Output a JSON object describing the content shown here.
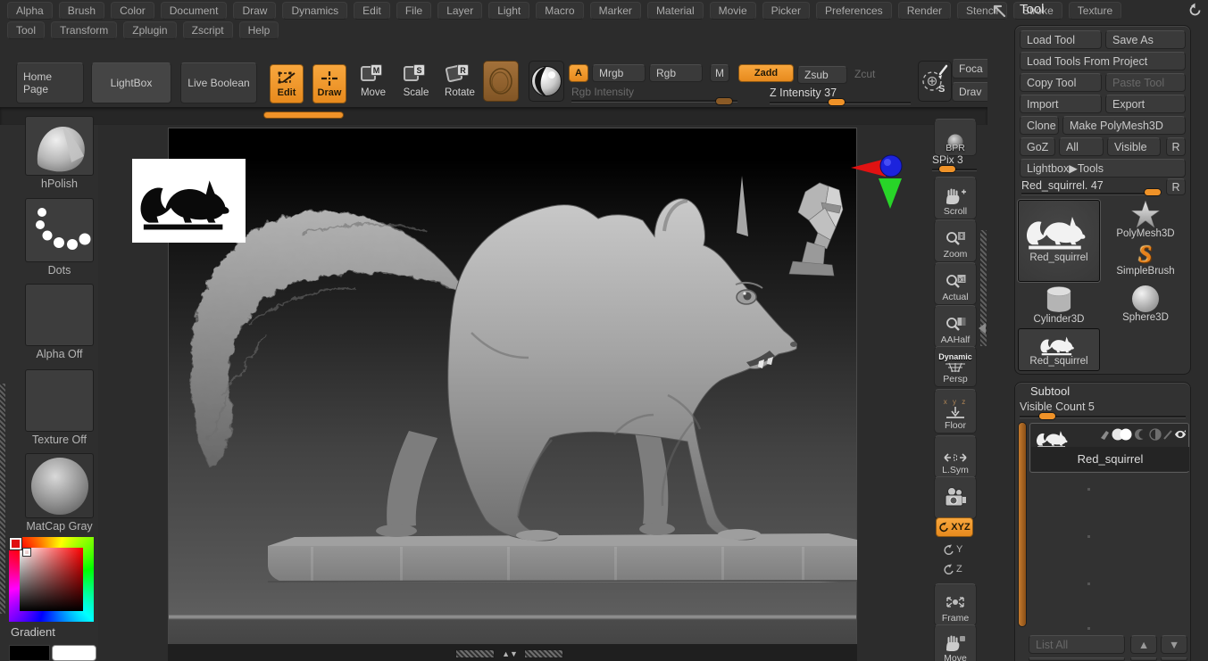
{
  "menus": {
    "row1": [
      "Alpha",
      "Brush",
      "Color",
      "Document",
      "Draw",
      "Dynamics",
      "Edit",
      "File",
      "Layer",
      "Light",
      "Macro",
      "Marker",
      "Material",
      "Movie",
      "Picker",
      "Preferences",
      "Render",
      "Stencil",
      "Stroke",
      "Texture"
    ],
    "row2": [
      "Tool",
      "Transform",
      "Zplugin",
      "Zscript",
      "Help"
    ]
  },
  "topbar": {
    "home": "Home Page",
    "lightbox": "LightBox",
    "live_boolean": "Live Boolean",
    "edit": "Edit",
    "draw": "Draw",
    "move": "Move",
    "scale": "Scale",
    "rotate": "Rotate",
    "move_badge": "M",
    "scale_badge": "S",
    "rotate_badge": "R",
    "a": "A",
    "mrgb": "Mrgb",
    "rgb": "Rgb",
    "m": "M",
    "zadd": "Zadd",
    "zsub": "Zsub",
    "zcut": "Zcut",
    "rgb_intensity": "Rgb Intensity",
    "z_intensity": "Z Intensity 37",
    "sym": "S",
    "focal_clip": "Foca",
    "draw_clip": "Drav"
  },
  "left_tray": {
    "items": [
      "hPolish",
      "Dots",
      "Alpha Off",
      "Texture Off",
      "MatCap Gray"
    ],
    "gradient": "Gradient"
  },
  "shelf": {
    "bpr": "BPR",
    "spix": "SPix 3",
    "scroll": "Scroll",
    "zoom": "Zoom",
    "actual": "Actual",
    "aahalf": "AAHalf",
    "dynamic": "Dynamic",
    "persp": "Persp",
    "floor_axes": "x y z",
    "floor": "Floor",
    "lsym": "L.Sym",
    "xyz": "XYZ",
    "rot_y": "Y",
    "rot_z": "Z",
    "frame": "Frame",
    "move": "Move"
  },
  "tool": {
    "title": "Tool",
    "load_tool": "Load Tool",
    "save_as": "Save As",
    "load_project": "Load Tools From Project",
    "copy": "Copy Tool",
    "paste": "Paste Tool",
    "import": "Import",
    "export": "Export",
    "clone": "Clone",
    "make_polymesh": "Make PolyMesh3D",
    "goz": "GoZ",
    "all": "All",
    "visible": "Visible",
    "r": "R",
    "lightbox_tools": "Lightbox▶Tools",
    "slider": "Red_squirrel. 47",
    "items": [
      "Red_squirrel",
      "PolyMesh3D",
      "SimpleBrush",
      "Cylinder3D",
      "Sphere3D",
      "Red_squirrel"
    ]
  },
  "subtool": {
    "title": "Subtool",
    "visible_count": "Visible Count 5",
    "selected": "Red_squirrel",
    "list_all": "List All",
    "up": "▲",
    "down": "▼"
  },
  "canvas_scroll": {
    "up": "▲",
    "down": "▼"
  },
  "colors": {
    "accent_orange": "#ef9228",
    "ui_bg": "#2c2c2c",
    "canvas_top": "#000000",
    "canvas_bottom": "#5e5e5e",
    "gizmo_red": "#e01212",
    "gizmo_blue": "#1c23dd",
    "gizmo_green": "#28d428"
  }
}
